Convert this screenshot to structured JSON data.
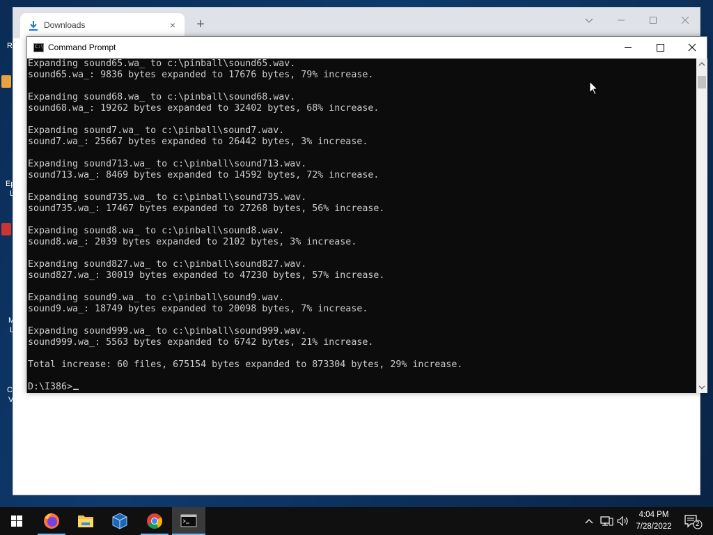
{
  "desktop": {
    "icon_labels": [
      "R",
      "Ep",
      "L",
      "M",
      "L",
      "C",
      "V"
    ]
  },
  "browser": {
    "tab_title": "Downloads",
    "new_tab_symbol": "+",
    "close_tab_symbol": "×"
  },
  "cmd": {
    "title": "Command Prompt",
    "icon_text": "C:\\_",
    "lines": [
      "Expanding sound65.wa_ to c:\\pinball\\sound65.wav.",
      "sound65.wa_: 9836 bytes expanded to 17676 bytes, 79% increase.",
      "",
      "Expanding sound68.wa_ to c:\\pinball\\sound68.wav.",
      "sound68.wa_: 19262 bytes expanded to 32402 bytes, 68% increase.",
      "",
      "Expanding sound7.wa_ to c:\\pinball\\sound7.wav.",
      "sound7.wa_: 25667 bytes expanded to 26442 bytes, 3% increase.",
      "",
      "Expanding sound713.wa_ to c:\\pinball\\sound713.wav.",
      "sound713.wa_: 8469 bytes expanded to 14592 bytes, 72% increase.",
      "",
      "Expanding sound735.wa_ to c:\\pinball\\sound735.wav.",
      "sound735.wa_: 17467 bytes expanded to 27268 bytes, 56% increase.",
      "",
      "Expanding sound8.wa_ to c:\\pinball\\sound8.wav.",
      "sound8.wa_: 2039 bytes expanded to 2102 bytes, 3% increase.",
      "",
      "Expanding sound827.wa_ to c:\\pinball\\sound827.wav.",
      "sound827.wa_: 30019 bytes expanded to 47230 bytes, 57% increase.",
      "",
      "Expanding sound9.wa_ to c:\\pinball\\sound9.wav.",
      "sound9.wa_: 18749 bytes expanded to 20098 bytes, 7% increase.",
      "",
      "Expanding sound999.wa_ to c:\\pinball\\sound999.wav.",
      "sound999.wa_: 5563 bytes expanded to 6742 bytes, 21% increase.",
      "",
      "Total increase: 60 files, 675154 bytes expanded to 873304 bytes, 29% increase.",
      ""
    ],
    "prompt": "D:\\I386>"
  },
  "taskbar": {
    "apps": [
      {
        "icon": "firefox-icon",
        "active": false
      },
      {
        "icon": "file-explorer-icon",
        "active": false
      },
      {
        "icon": "virtualbox-icon",
        "active": false
      },
      {
        "icon": "chrome-icon",
        "active": false
      },
      {
        "icon": "command-prompt-icon",
        "active": true
      }
    ],
    "time": "4:04 PM",
    "date": "7/28/2022",
    "notification_count": "2"
  },
  "colors": {
    "console_bg": "#0c0c0c",
    "console_text": "#cccccc",
    "taskbar_bg": "#101010",
    "accent": "#76b9ed"
  }
}
